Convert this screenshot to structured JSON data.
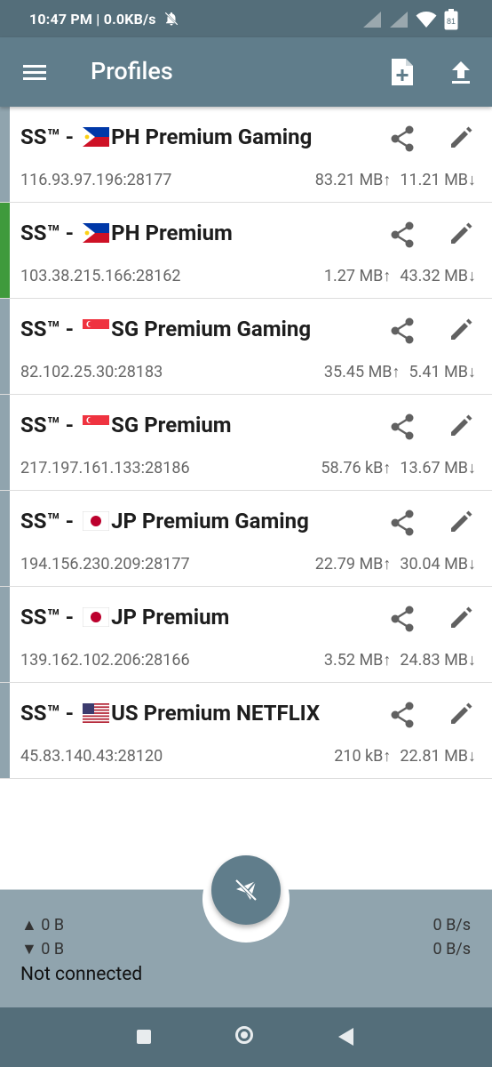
{
  "status_bar": {
    "time": "10:47 PM | 0.0KB/s",
    "battery": "81"
  },
  "app_bar": {
    "title": "Profiles"
  },
  "profiles": [
    {
      "name": "PH Premium Gaming",
      "prefix": "SS™ - ",
      "flag": "ph",
      "address": "116.93.97.196:28177",
      "upload": "83.21 MB↑",
      "download": "11.21 MB↓",
      "active": false
    },
    {
      "name": "PH Premium",
      "prefix": "SS™ - ",
      "flag": "ph",
      "address": "103.38.215.166:28162",
      "upload": "1.27 MB↑",
      "download": "43.32 MB↓",
      "active": true
    },
    {
      "name": "SG Premium Gaming",
      "prefix": "SS™ - ",
      "flag": "sg",
      "address": "82.102.25.30:28183",
      "upload": "35.45 MB↑",
      "download": "5.41 MB↓",
      "active": false
    },
    {
      "name": "SG Premium",
      "prefix": "SS™ - ",
      "flag": "sg",
      "address": "217.197.161.133:28186",
      "upload": "58.76 kB↑",
      "download": "13.67 MB↓",
      "active": false
    },
    {
      "name": "JP Premium Gaming",
      "prefix": "SS™ - ",
      "flag": "jp",
      "address": "194.156.230.209:28177",
      "upload": "22.79 MB↑",
      "download": "30.04 MB↓",
      "active": false
    },
    {
      "name": "JP Premium",
      "prefix": "SS™ - ",
      "flag": "jp",
      "address": "139.162.102.206:28166",
      "upload": "3.52 MB↑",
      "download": "24.83 MB↓",
      "active": false
    },
    {
      "name": "US Premium NETFLIX",
      "prefix": "SS™ - ",
      "flag": "us",
      "address": "45.83.140.43:28120",
      "upload": "210 kB↑",
      "download": "22.81 MB↓",
      "active": false
    }
  ],
  "bottom": {
    "up_total": "▲ 0 B",
    "down_total": "▼ 0 B",
    "up_rate": "0 B/s",
    "down_rate": "0 B/s",
    "connection_status": "Not connected"
  },
  "colors": {
    "primary": "#607d8b",
    "primary_dark": "#546e7a",
    "active_stripe": "#3f9a3c",
    "inactive_stripe": "#90a4ae"
  },
  "icons": {
    "menu": "menu-icon",
    "add": "add-profile-icon",
    "upload": "upload-icon",
    "share": "share-icon",
    "edit": "edit-icon",
    "connect": "airplane-off-icon"
  }
}
